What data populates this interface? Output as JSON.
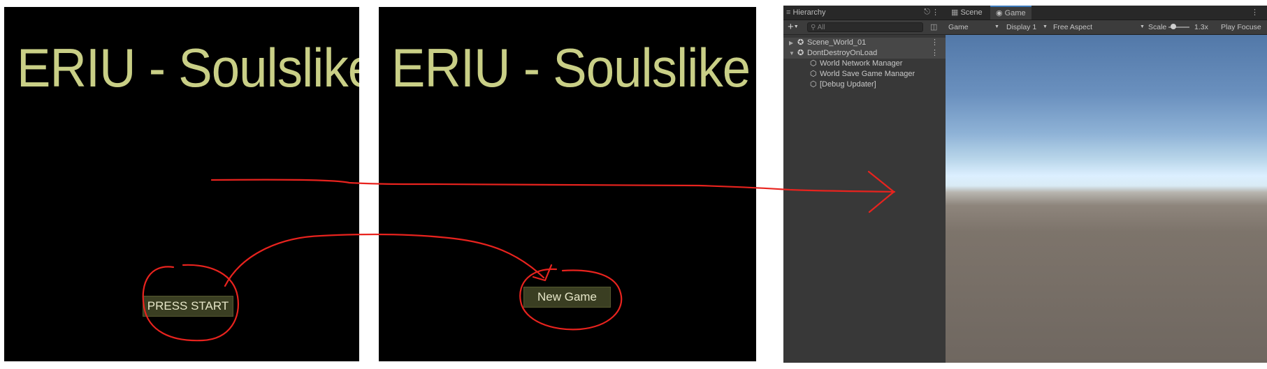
{
  "screens": [
    {
      "title": "ERIU - Soulslike",
      "button_label": "PRESS START"
    },
    {
      "title": "ERIU - Soulslike",
      "button_label": "New Game"
    }
  ],
  "editor": {
    "hierarchy": {
      "tab_label": "Hierarchy",
      "add_label": "+",
      "search_placeholder": "All",
      "items": [
        {
          "label": "Scene_World_01",
          "type": "scene"
        },
        {
          "label": "DontDestroyOnLoad",
          "type": "scene"
        },
        {
          "label": "World Network Manager",
          "type": "gameobject"
        },
        {
          "label": "World Save Game Manager",
          "type": "gameobject"
        },
        {
          "label": "[Debug Updater]",
          "type": "gameobject"
        }
      ]
    },
    "tabs": {
      "scene": "Scene",
      "game": "Game"
    },
    "game_toolbar": {
      "mode": "Game",
      "display": "Display 1",
      "aspect": "Free Aspect",
      "scale_label": "Scale",
      "scale_value": "1.3x",
      "play_mode": "Play Focuse"
    },
    "colors": {
      "sky_top": "#5278a8",
      "horizon": "#dcefff",
      "ground": "#6f6760",
      "active_tab": "#3a79bb"
    }
  },
  "title_color": "#c9cf86",
  "annotation_color": "#e8231e"
}
